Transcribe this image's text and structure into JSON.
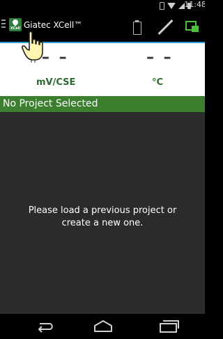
{
  "status_bar": {
    "time": "11:48",
    "icons": [
      "vibrate-icon",
      "wifi-icon",
      "signal-icon",
      "battery-icon"
    ]
  },
  "action_bar": {
    "app_icon_label": "XCell",
    "title": "Giatec XCell™",
    "actions": [
      "battery-status-icon",
      "probe-icon",
      "sync-icon"
    ],
    "accent_color": "#2aa0d5"
  },
  "readings": {
    "potential_value": "– –",
    "potential_unit": "mV/CSE",
    "temperature_value": "– –",
    "temperature_unit": "°C"
  },
  "project": {
    "status": "No Project Selected",
    "color": "#3c7f2f"
  },
  "main": {
    "message": "Please load a previous project or create a new one."
  },
  "nav_bar": {
    "buttons": [
      "back-icon",
      "home-icon",
      "recent-apps-icon"
    ]
  },
  "overlay": {
    "pointer": "hand-pointer-icon"
  }
}
